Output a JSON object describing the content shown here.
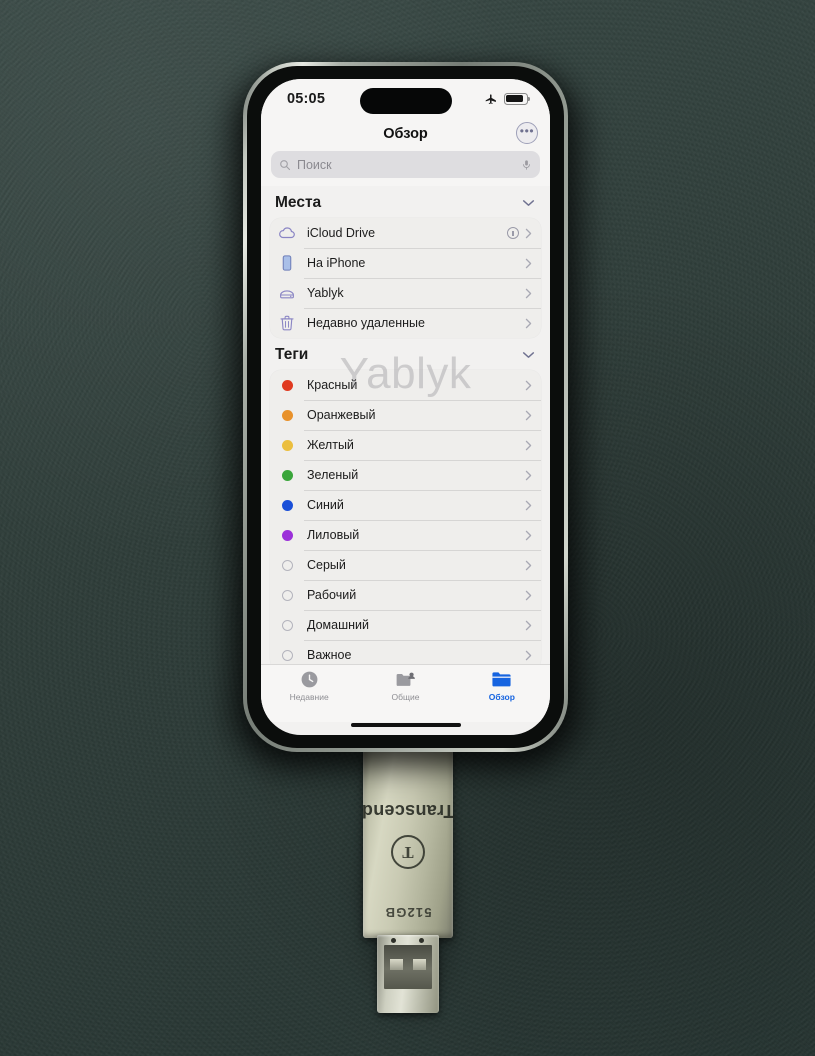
{
  "scene": {
    "background_color": "#2e3d39",
    "watermark": "Yablyk"
  },
  "usb_drive": {
    "brand": "Transcend",
    "capacity": "512GB",
    "logo_glyph": "T"
  },
  "phone": {
    "status_bar": {
      "time": "05:05",
      "airplane_icon": "airplane-mode-icon",
      "battery_icon": "battery-icon"
    },
    "nav": {
      "title": "Обзор",
      "more_button": "•••"
    },
    "search": {
      "placeholder": "Поиск",
      "search_icon": "search-icon",
      "mic_icon": "microphone-icon"
    },
    "sections": [
      {
        "title": "Места",
        "collapse_icon": "chevron-down-icon",
        "rows": [
          {
            "label": "iCloud Drive",
            "icon": "cloud-icon",
            "accessory": "sync-status-icon",
            "chevron": "chevron-right-icon"
          },
          {
            "label": "На iPhone",
            "icon": "iphone-icon",
            "accessory": "",
            "chevron": "chevron-right-icon"
          },
          {
            "label": "Yablyk",
            "icon": "external-drive-icon",
            "accessory": "",
            "chevron": "chevron-right-icon"
          },
          {
            "label": "Недавно удаленные",
            "icon": "trash-icon",
            "accessory": "",
            "chevron": "chevron-right-icon"
          }
        ]
      },
      {
        "title": "Теги",
        "collapse_icon": "chevron-down-icon",
        "rows": [
          {
            "label": "Красный",
            "color": "#e03a20",
            "hollow": false,
            "chevron": "chevron-right-icon"
          },
          {
            "label": "Оранжевый",
            "color": "#e8912a",
            "hollow": false,
            "chevron": "chevron-right-icon"
          },
          {
            "label": "Желтый",
            "color": "#ebbe3e",
            "hollow": false,
            "chevron": "chevron-right-icon"
          },
          {
            "label": "Зеленый",
            "color": "#3aa53a",
            "hollow": false,
            "chevron": "chevron-right-icon"
          },
          {
            "label": "Синий",
            "color": "#1a4fd8",
            "hollow": false,
            "chevron": "chevron-right-icon"
          },
          {
            "label": "Лиловый",
            "color": "#9b30d9",
            "hollow": false,
            "chevron": "chevron-right-icon"
          },
          {
            "label": "Серый",
            "color": "",
            "hollow": true,
            "chevron": "chevron-right-icon"
          },
          {
            "label": "Рабочий",
            "color": "",
            "hollow": true,
            "chevron": "chevron-right-icon"
          },
          {
            "label": "Домашний",
            "color": "",
            "hollow": true,
            "chevron": "chevron-right-icon"
          },
          {
            "label": "Важное",
            "color": "",
            "hollow": true,
            "chevron": "chevron-right-icon"
          }
        ]
      }
    ],
    "tab_bar": {
      "active_color": "#1664e0",
      "tabs": [
        {
          "label": "Недавние",
          "icon": "clock-icon",
          "active": false
        },
        {
          "label": "Общие",
          "icon": "shared-folder-icon",
          "active": false
        },
        {
          "label": "Обзор",
          "icon": "folder-icon",
          "active": true
        }
      ]
    }
  }
}
